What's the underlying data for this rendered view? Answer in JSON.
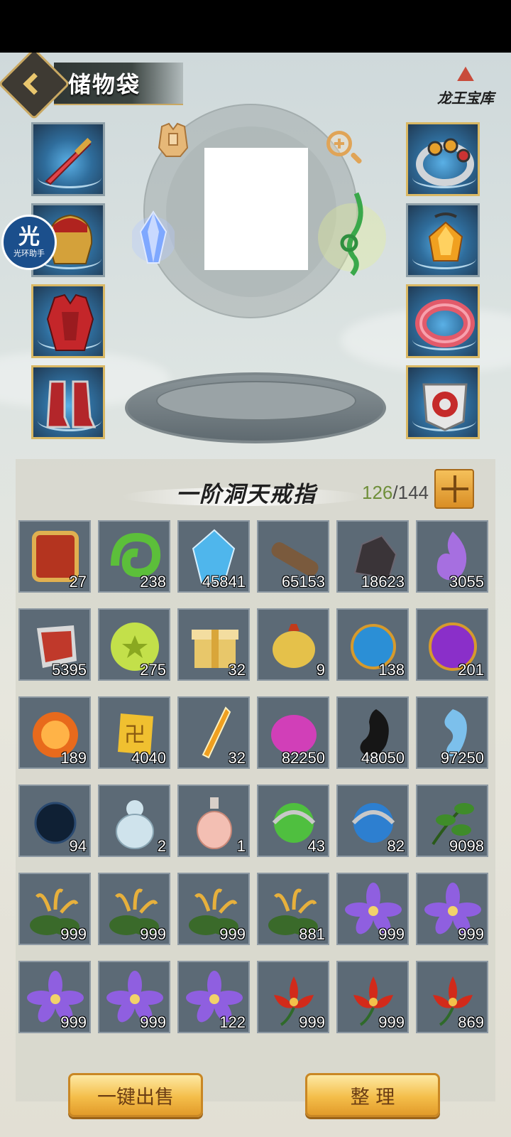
{
  "header": {
    "title": "储物袋",
    "treasury_label": "龙王宝库"
  },
  "helper": {
    "glyph": "光",
    "label": "光环助手"
  },
  "equipment": {
    "left": [
      {
        "name": "sword",
        "icon": "sword-icon"
      },
      {
        "name": "helmet",
        "icon": "helmet-icon"
      },
      {
        "name": "armor",
        "icon": "armor-icon"
      },
      {
        "name": "boots",
        "icon": "boots-icon"
      }
    ],
    "right": [
      {
        "name": "ring",
        "icon": "ring-icon"
      },
      {
        "name": "pendant",
        "icon": "pendant-icon"
      },
      {
        "name": "bracelet",
        "icon": "bracelet-icon"
      },
      {
        "name": "belt",
        "icon": "belt-icon"
      }
    ]
  },
  "bag": {
    "title": "一阶洞天戒指",
    "used": "126",
    "separator": "/",
    "capacity": "144"
  },
  "items": [
    {
      "icon": "token-icon",
      "qty": "27",
      "color": "#b4341f"
    },
    {
      "icon": "jade-dragon-icon",
      "qty": "238",
      "color": "#5cbf3a"
    },
    {
      "icon": "blue-crystal-icon",
      "qty": "45841",
      "color": "#4fb6ec"
    },
    {
      "icon": "wood-log-icon",
      "qty": "65153",
      "color": "#7a5a3d"
    },
    {
      "icon": "dark-ore-icon",
      "qty": "18623",
      "color": "#3a3438"
    },
    {
      "icon": "purple-flame-icon",
      "qty": "3055",
      "color": "#a66fe0"
    },
    {
      "icon": "red-badge-icon",
      "qty": "5395",
      "color": "#c0392b"
    },
    {
      "icon": "green-orb-icon",
      "qty": "275",
      "color": "#c3e04a"
    },
    {
      "icon": "gift-box-icon",
      "qty": "32",
      "color": "#e8c76a"
    },
    {
      "icon": "gold-pouch-icon",
      "qty": "9",
      "color": "#e5c14a"
    },
    {
      "icon": "blue-orb-icon",
      "qty": "138",
      "color": "#2b8fd6"
    },
    {
      "icon": "purple-orb-icon",
      "qty": "201",
      "color": "#8a2fc9"
    },
    {
      "icon": "fire-orb-icon",
      "qty": "189",
      "color": "#e86a1c"
    },
    {
      "icon": "gold-charm-icon",
      "qty": "4040",
      "color": "#f0c030"
    },
    {
      "icon": "amber-shard-icon",
      "qty": "32",
      "color": "#f0a020"
    },
    {
      "icon": "pink-egg-icon",
      "qty": "82250",
      "color": "#d13fb8"
    },
    {
      "icon": "black-magatama-icon",
      "qty": "48050",
      "color": "#161616"
    },
    {
      "icon": "blue-magatama-icon",
      "qty": "97250",
      "color": "#7cc0ec"
    },
    {
      "icon": "black-pearl-icon",
      "qty": "94",
      "color": "#0f2034"
    },
    {
      "icon": "white-gourd-icon",
      "qty": "2",
      "color": "#cfe3ec"
    },
    {
      "icon": "pink-gourd-icon",
      "qty": "1",
      "color": "#f3bfb3"
    },
    {
      "icon": "green-sphere-icon",
      "qty": "43",
      "color": "#4fbf3f"
    },
    {
      "icon": "blue-sphere-icon",
      "qty": "82",
      "color": "#2d7fd0"
    },
    {
      "icon": "leaf-herb-icon",
      "qty": "9098",
      "color": "#3f8c2a"
    },
    {
      "icon": "spider-lily-icon",
      "qty": "999",
      "color": "#e7b03c"
    },
    {
      "icon": "spider-lily-icon",
      "qty": "999",
      "color": "#e7b03c"
    },
    {
      "icon": "spider-lily-icon",
      "qty": "999",
      "color": "#e7b03c"
    },
    {
      "icon": "spider-lily-icon",
      "qty": "881",
      "color": "#e7b03c"
    },
    {
      "icon": "violet-flower-icon",
      "qty": "999",
      "color": "#8f5fe0"
    },
    {
      "icon": "violet-flower-icon",
      "qty": "999",
      "color": "#8f5fe0"
    },
    {
      "icon": "violet-flower-icon",
      "qty": "999",
      "color": "#8f5fe0"
    },
    {
      "icon": "violet-flower-icon",
      "qty": "999",
      "color": "#8f5fe0"
    },
    {
      "icon": "violet-flower-icon",
      "qty": "122",
      "color": "#8f5fe0"
    },
    {
      "icon": "red-lotus-icon",
      "qty": "999",
      "color": "#d22a1a"
    },
    {
      "icon": "red-lotus-icon",
      "qty": "999",
      "color": "#d22a1a"
    },
    {
      "icon": "red-lotus-icon",
      "qty": "869",
      "color": "#d22a1a"
    }
  ],
  "actions": {
    "sell_all": "一键出售",
    "sort": "整 理"
  }
}
